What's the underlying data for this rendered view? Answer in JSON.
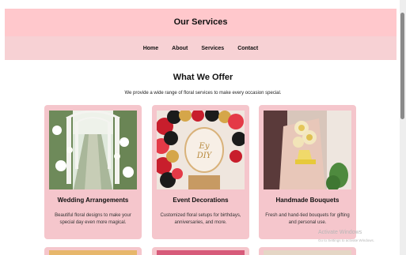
{
  "header": {
    "title": "Our Services"
  },
  "nav": {
    "items": [
      "Home",
      "About",
      "Services",
      "Contact"
    ]
  },
  "section": {
    "title": "What We Offer",
    "subtitle": "We provide a wide range of floral services to make every occasion special."
  },
  "cards": [
    {
      "title": "Wedding Arrangements",
      "desc": "Beautiful floral designs to make your special day even more magical."
    },
    {
      "title": "Event Decorations",
      "desc": "Customized floral setups for birthdays, anniversaries, and more."
    },
    {
      "title": "Handmade Bouquets",
      "desc": "Fresh and hand-tied bouquets for gifting and personal use."
    }
  ],
  "watermark": {
    "line1": "Activate Windows",
    "line2": "Go to Settings to activate Windows."
  },
  "colors": {
    "header": "#ffc8cc",
    "nav": "#f7d1d4",
    "card": "#f5c6cc"
  }
}
